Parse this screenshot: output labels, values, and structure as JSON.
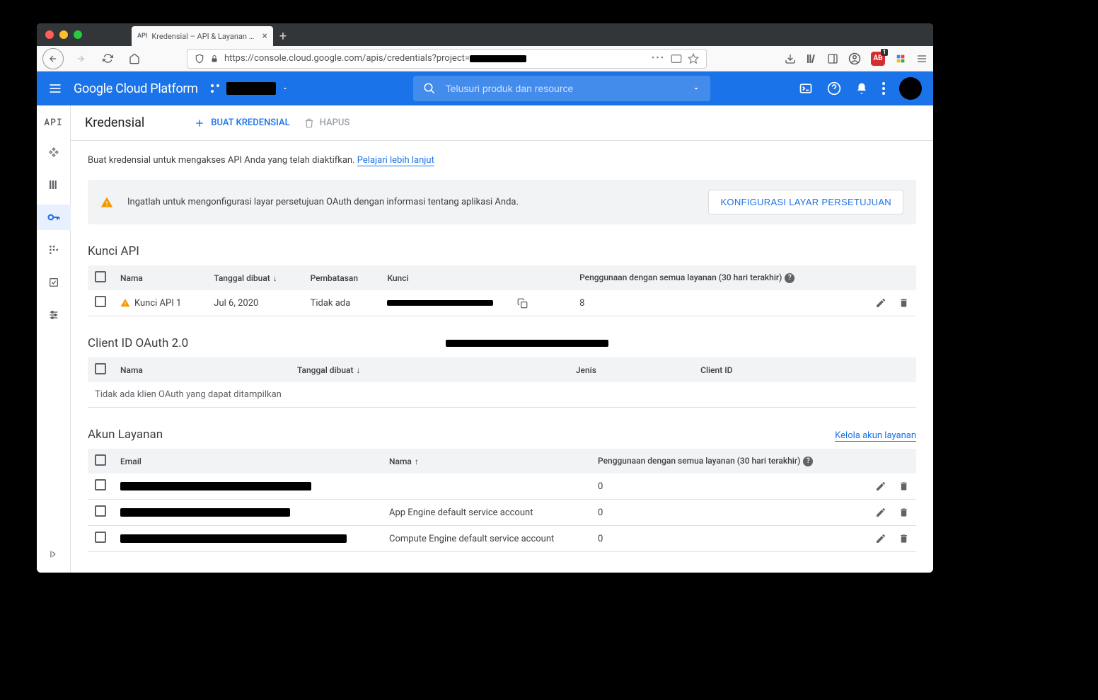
{
  "browser": {
    "tab_title": "Kredensial – API & Layanan – C",
    "tab_icon": "API",
    "url_prefix": "https://console.cloud.google.com/apis/credentials?project="
  },
  "gcp": {
    "brand": "Google Cloud Platform",
    "search_placeholder": "Telusuri produk dan resource"
  },
  "sidebar": {
    "api_label": "API"
  },
  "page": {
    "title": "Kredensial",
    "create_btn": "BUAT KREDENSIAL",
    "delete_btn": "HAPUS",
    "intro": "Buat kredensial untuk mengakses API Anda yang telah diaktifkan.",
    "learn_more": "Pelajari lebih lanjut"
  },
  "alert": {
    "text": "Ingatlah untuk mengonfigurasi layar persetujuan OAuth dengan informasi tentang aplikasi Anda.",
    "button": "KONFIGURASI LAYAR PERSETUJUAN"
  },
  "apikeys": {
    "title": "Kunci API",
    "cols": {
      "name": "Nama",
      "created": "Tanggal dibuat",
      "restriction": "Pembatasan",
      "key": "Kunci",
      "usage": "Penggunaan dengan semua layanan (30 hari terakhir)"
    },
    "rows": [
      {
        "name": "Kunci API 1",
        "created": "Jul 6, 2020",
        "restriction": "Tidak ada",
        "usage": "8"
      }
    ]
  },
  "oauth": {
    "title": "Client ID OAuth 2.0",
    "cols": {
      "name": "Nama",
      "created": "Tanggal dibuat",
      "type": "Jenis",
      "clientid": "Client ID"
    },
    "empty": "Tidak ada klien OAuth yang dapat ditampilkan"
  },
  "svcacct": {
    "title": "Akun Layanan",
    "manage": "Kelola akun layanan",
    "cols": {
      "email": "Email",
      "name": "Nama",
      "usage": "Penggunaan dengan semua layanan (30 hari terakhir)"
    },
    "rows": [
      {
        "name": "",
        "usage": "0"
      },
      {
        "name": "App Engine default service account",
        "usage": "0"
      },
      {
        "name": "Compute Engine default service account",
        "usage": "0"
      }
    ]
  }
}
